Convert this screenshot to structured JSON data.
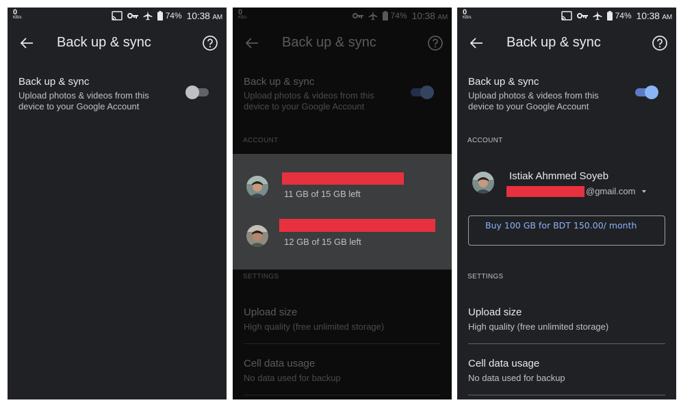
{
  "status_bar": {
    "kbs_value": "0",
    "kbs_unit": "KB/s",
    "battery_pct": "74%",
    "time": "10:38",
    "ampm": "AM"
  },
  "app_bar": {
    "title": "Back up & sync"
  },
  "backup_toggle": {
    "title": "Back up & sync",
    "subtitle": "Upload photos & videos from this device to your Google Account",
    "panel_states": [
      "off",
      "on",
      "on"
    ]
  },
  "account_section": {
    "label": "ACCOUNT",
    "accounts": [
      {
        "storage": "11 GB of 15 GB left"
      },
      {
        "storage": "12 GB of 15 GB left"
      }
    ],
    "selected": {
      "name": "Istiak Ahmmed Soyeb",
      "email_suffix": "@gmail.com"
    },
    "buy_button": "Buy 100 GB for BDT 150.00/ month"
  },
  "settings_section": {
    "label": "SETTINGS",
    "upload_size": {
      "title": "Upload size",
      "value": "High quality (free unlimited storage)"
    },
    "cell_data": {
      "title": "Cell data usage",
      "value": "No data used for backup"
    }
  },
  "colors": {
    "background": "#202124",
    "sheet": "#3c3d3f",
    "accent": "#8ab4f8",
    "redaction": "#e8313f"
  },
  "icons": [
    "cast-icon",
    "vpn-key-icon",
    "airplane-icon",
    "battery-icon",
    "back-arrow-icon",
    "help-icon",
    "dropdown-caret-icon"
  ]
}
